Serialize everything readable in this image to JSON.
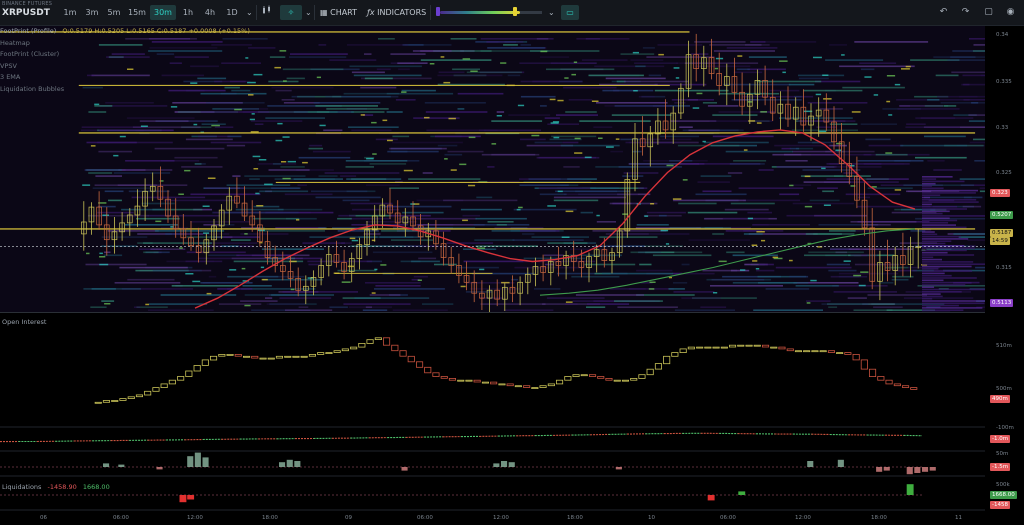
{
  "toolbar": {
    "exchange": "BINANCE FUTURES",
    "symbol": "XRPUSDT",
    "timeframes": [
      {
        "label": "1m",
        "active": false
      },
      {
        "label": "3m",
        "active": false
      },
      {
        "label": "5m",
        "active": false
      },
      {
        "label": "15m",
        "active": false
      },
      {
        "label": "30m",
        "active": true
      },
      {
        "label": "1h",
        "active": false
      },
      {
        "label": "4h",
        "active": false
      },
      {
        "label": "1D",
        "active": false
      }
    ],
    "chart_label": "CHART",
    "indicators_label": "INDICATORS",
    "accent_color": "#2ed1c4",
    "heatmap_contrast_level": 0.7,
    "icons": [
      "chevron-down-icon",
      "candles-icon",
      "drawing-tool-icon",
      "chart-settings-icon",
      "function-icon",
      "camera-view-icon",
      "undo-icon",
      "redo-icon",
      "fullscreen-icon",
      "camera-icon"
    ]
  },
  "legend": {
    "indicators": [
      "FootPrint (Profile)",
      "Heatmap",
      "FootPrint (Cluster)",
      "VPSV",
      "3 EMA",
      "Liquidation Bubbles"
    ],
    "ohlc": "O:0.5179 H:0.5205 L:0.5165 C:0.5187 +0.0008 (+0.15%)"
  },
  "price_axis": {
    "ticks": [
      "0.34",
      "0.335",
      "0.33",
      "0.325",
      "0.32",
      "0.315"
    ],
    "badges": [
      {
        "value": "0.323",
        "color": "#e2575a"
      },
      {
        "value": "0.5207",
        "color": "#3d9a4a"
      },
      {
        "value": "0.5187",
        "color": "#c9b44a"
      },
      {
        "value": "14:59",
        "color": "#c9b44a"
      },
      {
        "value": "0.5113",
        "color": "#8b3fc8"
      }
    ]
  },
  "open_interest": {
    "label": "Open Interest",
    "ticks": [
      "510m",
      "500m"
    ],
    "badge": "490m",
    "delta_ticks": [
      "-100m"
    ],
    "delta_badge": "-1.0m",
    "vol_ticks": [
      "50m"
    ],
    "vol_badge": "-1.5m"
  },
  "liquidations": {
    "label": "Liquidations",
    "sell_value": "-1458.90",
    "buy_value": "1668.00",
    "ticks": [
      "500k"
    ],
    "badges": [
      {
        "value": "1668.00",
        "color": "#3d9a4a"
      },
      {
        "value": "-1458",
        "color": "#e2575a"
      }
    ]
  },
  "time_axis": [
    "06",
    "06:00",
    "12:00",
    "18:00",
    "09",
    "06:00",
    "12:00",
    "18:00",
    "10",
    "06:00",
    "12:00",
    "18:00",
    "11"
  ],
  "chart_data": {
    "type": "candlestick",
    "price_range": [
      0.312,
      0.341
    ],
    "candles": [
      [
        0.32,
        0.3233,
        0.3183,
        0.3212
      ],
      [
        0.3212,
        0.3232,
        0.3199,
        0.3227
      ],
      [
        0.3227,
        0.3243,
        0.3204,
        0.3209
      ],
      [
        0.3209,
        0.3227,
        0.3178,
        0.3194
      ],
      [
        0.3194,
        0.3217,
        0.318,
        0.3202
      ],
      [
        0.3202,
        0.3222,
        0.3193,
        0.3211
      ],
      [
        0.3211,
        0.3226,
        0.3198,
        0.3219
      ],
      [
        0.3219,
        0.3245,
        0.3207,
        0.3228
      ],
      [
        0.3228,
        0.3256,
        0.3213,
        0.3243
      ],
      [
        0.3243,
        0.3262,
        0.3233,
        0.3248
      ],
      [
        0.3248,
        0.3268,
        0.3227,
        0.3235
      ],
      [
        0.3235,
        0.3244,
        0.3211,
        0.3218
      ],
      [
        0.3218,
        0.3236,
        0.3196,
        0.3205
      ],
      [
        0.3205,
        0.322,
        0.3189,
        0.3196
      ],
      [
        0.3196,
        0.3213,
        0.3183,
        0.3188
      ],
      [
        0.3188,
        0.3206,
        0.3171,
        0.3181
      ],
      [
        0.3181,
        0.32,
        0.3169,
        0.3194
      ],
      [
        0.3194,
        0.3215,
        0.3183,
        0.3208
      ],
      [
        0.3208,
        0.323,
        0.3195,
        0.3224
      ],
      [
        0.3224,
        0.3247,
        0.3209,
        0.3238
      ],
      [
        0.3238,
        0.3257,
        0.3226,
        0.3231
      ],
      [
        0.3231,
        0.3248,
        0.3213,
        0.3218
      ],
      [
        0.3218,
        0.3234,
        0.3202,
        0.3209
      ],
      [
        0.3209,
        0.3223,
        0.3187,
        0.3192
      ],
      [
        0.3192,
        0.3203,
        0.3169,
        0.3176
      ],
      [
        0.3176,
        0.3188,
        0.3161,
        0.3168
      ],
      [
        0.3168,
        0.3182,
        0.3153,
        0.3162
      ],
      [
        0.3162,
        0.3177,
        0.3146,
        0.3155
      ],
      [
        0.3155,
        0.3166,
        0.3137,
        0.3143
      ],
      [
        0.3143,
        0.3158,
        0.3129,
        0.3147
      ],
      [
        0.3147,
        0.3163,
        0.3138,
        0.3156
      ],
      [
        0.3156,
        0.3175,
        0.3148,
        0.3168
      ],
      [
        0.3168,
        0.3188,
        0.3157,
        0.3179
      ],
      [
        0.3179,
        0.3193,
        0.3166,
        0.3171
      ],
      [
        0.3171,
        0.3184,
        0.3154,
        0.3162
      ],
      [
        0.3162,
        0.3181,
        0.3151,
        0.3175
      ],
      [
        0.3175,
        0.3196,
        0.3164,
        0.3189
      ],
      [
        0.3189,
        0.3213,
        0.3178,
        0.3204
      ],
      [
        0.3204,
        0.3229,
        0.3192,
        0.3218
      ],
      [
        0.3218,
        0.3236,
        0.3206,
        0.3229
      ],
      [
        0.3229,
        0.3246,
        0.3215,
        0.3221
      ],
      [
        0.3221,
        0.3234,
        0.3204,
        0.3211
      ],
      [
        0.3211,
        0.3226,
        0.3197,
        0.3217
      ],
      [
        0.3217,
        0.3233,
        0.3203,
        0.3208
      ],
      [
        0.3208,
        0.322,
        0.3189,
        0.3197
      ],
      [
        0.3197,
        0.3211,
        0.3183,
        0.3203
      ],
      [
        0.3203,
        0.3214,
        0.3184,
        0.319
      ],
      [
        0.319,
        0.3202,
        0.3168,
        0.3176
      ],
      [
        0.3176,
        0.3187,
        0.316,
        0.3168
      ],
      [
        0.3168,
        0.318,
        0.315,
        0.3158
      ],
      [
        0.3158,
        0.3172,
        0.3143,
        0.3151
      ],
      [
        0.3151,
        0.3163,
        0.3131,
        0.314
      ],
      [
        0.314,
        0.3153,
        0.3123,
        0.3135
      ],
      [
        0.3135,
        0.3148,
        0.3121,
        0.3143
      ],
      [
        0.3143,
        0.3154,
        0.3127,
        0.3134
      ],
      [
        0.3134,
        0.315,
        0.3122,
        0.3146
      ],
      [
        0.3146,
        0.3158,
        0.3131,
        0.314
      ],
      [
        0.314,
        0.3157,
        0.3128,
        0.3151
      ],
      [
        0.3151,
        0.3166,
        0.3139,
        0.3159
      ],
      [
        0.3159,
        0.3176,
        0.3147,
        0.3167
      ],
      [
        0.3167,
        0.3179,
        0.3152,
        0.3161
      ],
      [
        0.3161,
        0.3177,
        0.3148,
        0.3172
      ],
      [
        0.3172,
        0.3187,
        0.3157,
        0.3168
      ],
      [
        0.3168,
        0.3183,
        0.3154,
        0.3178
      ],
      [
        0.3178,
        0.3193,
        0.3162,
        0.3172
      ],
      [
        0.3172,
        0.3184,
        0.3156,
        0.3166
      ],
      [
        0.3166,
        0.3181,
        0.3151,
        0.3177
      ],
      [
        0.3177,
        0.3189,
        0.3161,
        0.3184
      ],
      [
        0.3184,
        0.3196,
        0.3166,
        0.3173
      ],
      [
        0.3173,
        0.3186,
        0.316,
        0.3181
      ],
      [
        0.3181,
        0.3208,
        0.3176,
        0.3203
      ],
      [
        0.3203,
        0.3262,
        0.3196,
        0.3255
      ],
      [
        0.3255,
        0.3312,
        0.3243,
        0.3296
      ],
      [
        0.3296,
        0.3319,
        0.3279,
        0.3288
      ],
      [
        0.3288,
        0.3309,
        0.3268,
        0.3301
      ],
      [
        0.3301,
        0.3327,
        0.329,
        0.3314
      ],
      [
        0.3314,
        0.3336,
        0.3296,
        0.3305
      ],
      [
        0.3305,
        0.3329,
        0.3291,
        0.3322
      ],
      [
        0.3322,
        0.3352,
        0.3316,
        0.3347
      ],
      [
        0.3347,
        0.3395,
        0.3338,
        0.3381
      ],
      [
        0.3381,
        0.3402,
        0.3354,
        0.3367
      ],
      [
        0.3367,
        0.339,
        0.3349,
        0.3378
      ],
      [
        0.3378,
        0.3397,
        0.3356,
        0.3362
      ],
      [
        0.3362,
        0.3383,
        0.334,
        0.335
      ],
      [
        0.335,
        0.3372,
        0.333,
        0.3359
      ],
      [
        0.3359,
        0.3378,
        0.3335,
        0.3343
      ],
      [
        0.3343,
        0.3363,
        0.332,
        0.3329
      ],
      [
        0.3329,
        0.3352,
        0.3311,
        0.3341
      ],
      [
        0.3341,
        0.3366,
        0.3326,
        0.3355
      ],
      [
        0.3355,
        0.337,
        0.333,
        0.3338
      ],
      [
        0.3338,
        0.3356,
        0.3314,
        0.3322
      ],
      [
        0.3322,
        0.3344,
        0.3305,
        0.3331
      ],
      [
        0.3331,
        0.3349,
        0.3308,
        0.3316
      ],
      [
        0.3316,
        0.3338,
        0.3299,
        0.3328
      ],
      [
        0.3328,
        0.3346,
        0.3303,
        0.331
      ],
      [
        0.331,
        0.3332,
        0.3294,
        0.3319
      ],
      [
        0.3319,
        0.3338,
        0.3298,
        0.3325
      ],
      [
        0.3325,
        0.3342,
        0.3304,
        0.3313
      ],
      [
        0.3313,
        0.3329,
        0.3285,
        0.3293
      ],
      [
        0.3293,
        0.3312,
        0.3262,
        0.3271
      ],
      [
        0.3271,
        0.3293,
        0.325,
        0.3258
      ],
      [
        0.3258,
        0.3278,
        0.3226,
        0.3234
      ],
      [
        0.3234,
        0.3252,
        0.3198,
        0.3206
      ],
      [
        0.3206,
        0.3226,
        0.3144,
        0.3152
      ],
      [
        0.3152,
        0.3183,
        0.3133,
        0.3171
      ],
      [
        0.3171,
        0.3194,
        0.3152,
        0.3163
      ],
      [
        0.3163,
        0.3187,
        0.3148,
        0.3178
      ],
      [
        0.3178,
        0.3201,
        0.3157,
        0.3169
      ],
      [
        0.3169,
        0.3197,
        0.3156,
        0.3187
      ],
      [
        0.3187,
        0.3205,
        0.3165,
        0.3187
      ]
    ],
    "ema_red": [
      0.3125,
      0.3135,
      0.3148,
      0.3162,
      0.3175,
      0.3186,
      0.3196,
      0.3204,
      0.3209,
      0.3208,
      0.3203,
      0.3196,
      0.3188,
      0.3181,
      0.3175,
      0.3172,
      0.3174,
      0.3178,
      0.3188,
      0.321,
      0.3238,
      0.3262,
      0.328,
      0.3292,
      0.3299,
      0.3303,
      0.3305,
      0.3302,
      0.329,
      0.327,
      0.3248,
      0.3232,
      0.3225
    ],
    "ema_green": [
      0.3138,
      0.314,
      0.3143,
      0.3148,
      0.3154,
      0.316,
      0.3166,
      0.3173,
      0.318,
      0.3187,
      0.3194,
      0.3199,
      0.3203,
      0.3205
    ],
    "levels": [
      {
        "y": 0.3404,
        "x0": 0.0,
        "x1": 0.7,
        "w": 1.4
      },
      {
        "y": 0.335,
        "x0": 0.08,
        "x1": 0.68,
        "w": 1.1
      },
      {
        "y": 0.3302,
        "x0": 0.08,
        "x1": 0.99,
        "w": 1.4
      },
      {
        "y": 0.3252,
        "x0": 0.28,
        "x1": 0.65,
        "w": 1.1
      },
      {
        "y": 0.3205,
        "x0": 0.0,
        "x1": 0.99,
        "w": 1.4
      },
      {
        "y": 0.316,
        "x0": 0.34,
        "x1": 0.5,
        "w": 1.0
      }
    ],
    "open_interest": [
      482,
      482,
      483,
      483,
      484,
      485,
      486,
      488,
      490,
      492,
      494,
      496,
      499,
      502,
      505,
      507,
      508,
      508,
      507,
      507,
      506,
      506,
      506,
      507,
      507,
      507,
      507,
      508,
      509,
      509,
      510,
      511,
      512,
      514,
      516,
      517,
      513,
      510,
      507,
      504,
      501,
      498,
      496,
      495,
      494,
      494,
      494,
      493,
      493,
      492,
      492,
      491,
      491,
      490,
      490,
      491,
      492,
      494,
      496,
      497,
      497,
      496,
      495,
      494,
      494,
      494,
      495,
      497,
      500,
      503,
      507,
      509,
      511,
      512,
      512,
      512,
      512,
      512,
      513,
      513,
      513,
      513,
      512,
      512,
      511,
      510,
      510,
      510,
      510,
      510,
      509,
      509,
      508,
      505,
      500,
      496,
      494,
      492,
      491,
      490,
      489
    ],
    "oi_delta": [
      0.04,
      0.05,
      0.05,
      0.07,
      0.1,
      0.12,
      0.14,
      0.16,
      0.18,
      0.2,
      0.22,
      0.25,
      0.27,
      0.29,
      0.31,
      0.32,
      0.34,
      0.35,
      0.37,
      0.39,
      0.42,
      0.44,
      0.46,
      0.49,
      0.52,
      0.54,
      0.56,
      0.59,
      0.62,
      0.64,
      0.66,
      0.69,
      0.72,
      0.76,
      0.79,
      0.82,
      0.84,
      0.86,
      0.87,
      0.86,
      0.84,
      0.82,
      0.8,
      0.79,
      0.78,
      0.75,
      0.72,
      0.7,
      0.68,
      0.66,
      0.63
    ],
    "vpsv_bars": [
      [
        3,
        0.3
      ],
      [
        5,
        0.2
      ],
      [
        10,
        -0.2
      ],
      [
        14,
        0.9
      ],
      [
        15,
        1.2
      ],
      [
        16,
        0.8
      ],
      [
        26,
        0.4
      ],
      [
        27,
        0.6
      ],
      [
        28,
        0.5
      ],
      [
        42,
        -0.3
      ],
      [
        54,
        0.3
      ],
      [
        55,
        0.5
      ],
      [
        56,
        0.4
      ],
      [
        70,
        -0.2
      ],
      [
        95,
        0.5
      ],
      [
        99,
        0.6
      ],
      [
        104,
        -0.4
      ],
      [
        105,
        -0.3
      ],
      [
        108,
        -0.6
      ],
      [
        109,
        -0.5
      ],
      [
        110,
        -0.4
      ],
      [
        111,
        -0.3
      ]
    ],
    "liq_bars": [
      [
        13,
        -0.8
      ],
      [
        14,
        -0.5
      ],
      [
        82,
        -0.6
      ],
      [
        86,
        0.4
      ],
      [
        108,
        1.2
      ]
    ]
  }
}
